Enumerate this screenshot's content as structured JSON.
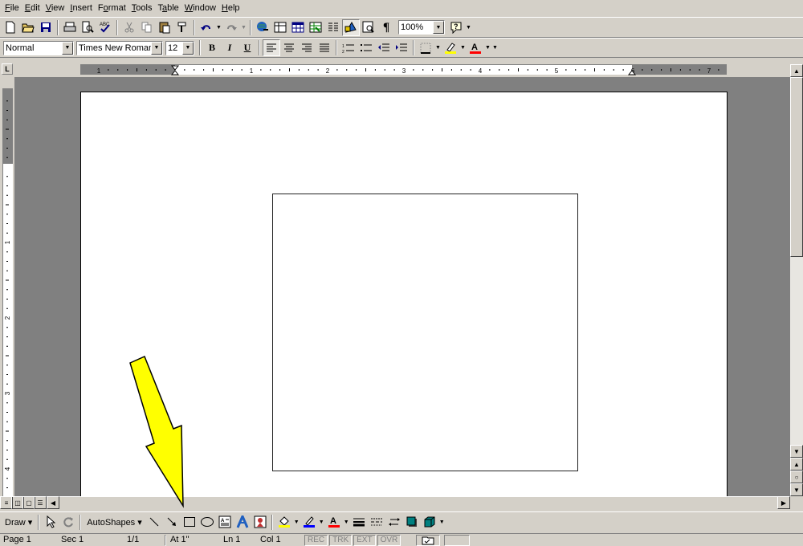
{
  "menu": [
    "File",
    "Edit",
    "View",
    "Insert",
    "Format",
    "Tools",
    "Table",
    "Window",
    "Help"
  ],
  "menu_accel": [
    0,
    0,
    0,
    0,
    1,
    0,
    1,
    0,
    0
  ],
  "toolbar": {
    "zoom": "100%"
  },
  "formatting": {
    "style": "Normal",
    "font": "Times New Roman",
    "size": "12"
  },
  "ruler": {
    "h_marks": [
      "1",
      "1",
      "2",
      "3",
      "4",
      "5",
      "6",
      "7"
    ],
    "v_marks": [
      "1",
      "2",
      "3",
      "4"
    ]
  },
  "drawing": {
    "draw_label": "Draw",
    "autoshapes_label": "AutoShapes"
  },
  "status": {
    "page": "Page 1",
    "sec": "Sec 1",
    "pages": "1/1",
    "at": "At 1\"",
    "ln": "Ln 1",
    "col": "Col 1",
    "rec": "REC",
    "trk": "TRK",
    "ext": "EXT",
    "ovr": "OVR"
  },
  "colors": {
    "chrome": "#d4d0c8",
    "workspace": "#808080",
    "highlight_arrow": "#ffff00"
  },
  "icons": {
    "standard": [
      "new-icon",
      "open-icon",
      "save-icon",
      "print-icon",
      "print-preview-icon",
      "spelling-icon",
      "cut-icon",
      "copy-icon",
      "paste-icon",
      "format-painter-icon",
      "undo-icon",
      "redo-icon",
      "hyperlink-icon",
      "tables-borders-icon",
      "insert-table-icon",
      "insert-excel-icon",
      "columns-icon",
      "drawing-icon",
      "document-map-icon",
      "show-hide-icon",
      "help-icon"
    ],
    "drawing": [
      "select-objects-icon",
      "free-rotate-icon",
      "line-icon",
      "arrow-icon",
      "rectangle-icon",
      "oval-icon",
      "text-box-icon",
      "wordart-icon",
      "clipart-icon",
      "fill-color-icon",
      "line-color-icon",
      "font-color-icon",
      "line-style-icon",
      "dash-style-icon",
      "arrow-style-icon",
      "shadow-icon",
      "3d-icon"
    ]
  }
}
